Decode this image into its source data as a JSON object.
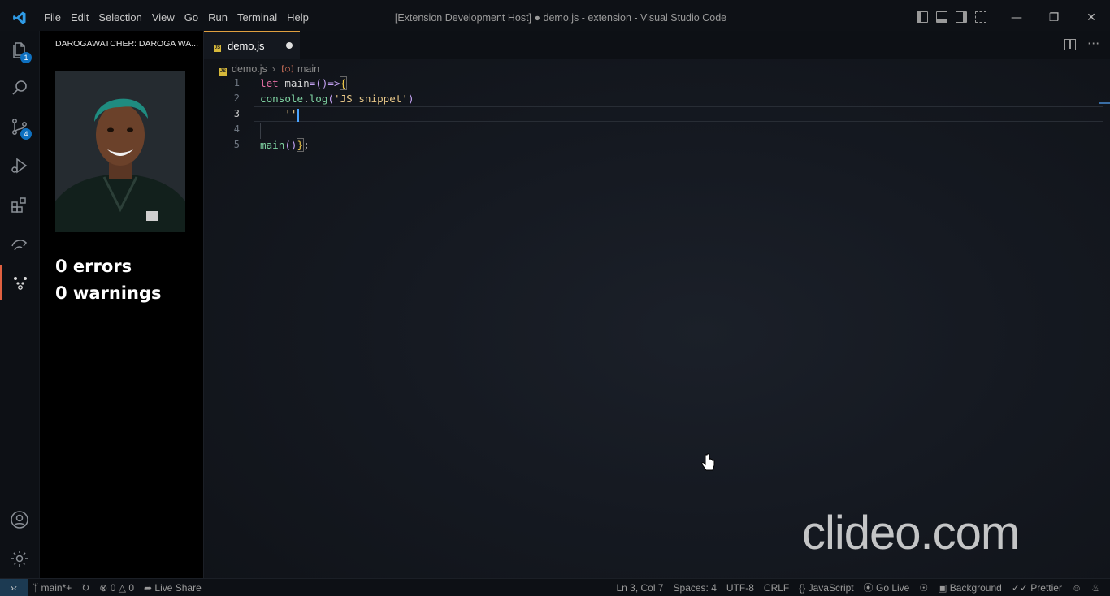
{
  "window": {
    "title": "[Extension Development Host] ● demo.js - extension - Visual Studio Code",
    "menu": [
      "File",
      "Edit",
      "Selection",
      "View",
      "Go",
      "Run",
      "Terminal",
      "Help"
    ]
  },
  "activity_bar": {
    "explorer_badge": "1",
    "source_control_badge": "4"
  },
  "sidebar": {
    "title": "DAROGAWATCHER: DAROGA WA...",
    "errors": "0 errors",
    "warnings": "0 warnings"
  },
  "editor": {
    "tab_label": "demo.js",
    "breadcrumb": {
      "file": "demo.js",
      "symbol": "main"
    },
    "active_line": 3,
    "lines": [
      {
        "n": "1"
      },
      {
        "n": "2"
      },
      {
        "n": "3"
      },
      {
        "n": "4"
      },
      {
        "n": "5"
      }
    ],
    "code": {
      "l1_kw": "let",
      "l1_name": " main",
      "l1_rest": "=()=>",
      "l1_brace": "{",
      "l2_obj": "console",
      "l2_dot": ".",
      "l2_fn": "log",
      "l2_open": "(",
      "l2_str": "'JS snippet'",
      "l2_close": ")",
      "l3": "    ''",
      "l5_fn": "main",
      "l5_paren": "()",
      "l5_brace": "}",
      "l5_semi": ";"
    },
    "watermark": "clideo.com"
  },
  "statusbar": {
    "branch": "main*+",
    "errors": "0",
    "warnings": "0",
    "live_share": "Live Share",
    "position": "Ln 3, Col 7",
    "spaces": "Spaces: 4",
    "encoding": "UTF-8",
    "eol": "CRLF",
    "language": "JavaScript",
    "go_live": "Go Live",
    "background": "Background",
    "prettier": "Prettier"
  },
  "colors": {
    "tab_accent": "#e0a040",
    "caret": "#4aa3ff",
    "badge": "#0e70c0",
    "keyword": "#e56fa4",
    "function": "#7fd3a2",
    "string": "#e8c788"
  }
}
